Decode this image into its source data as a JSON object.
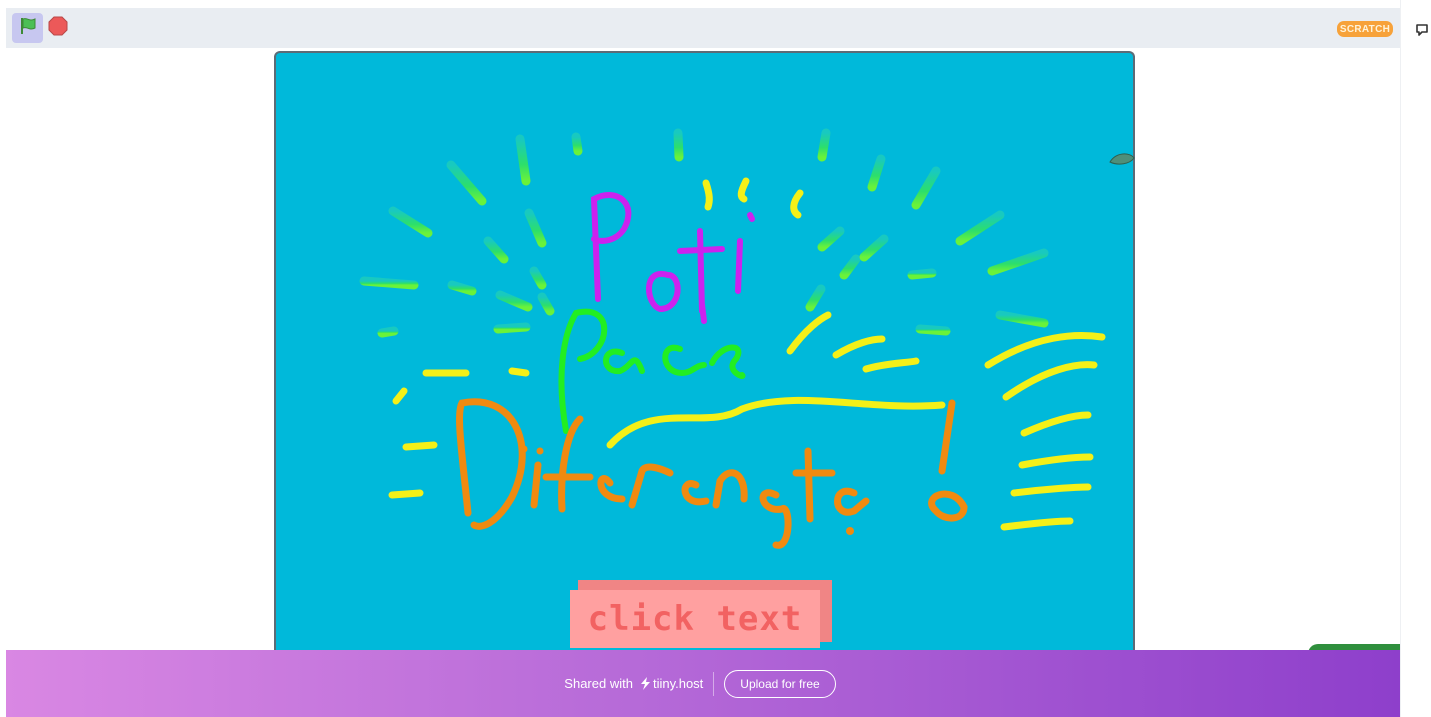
{
  "toolbar": {
    "green_flag_icon": "green-flag-icon",
    "stop_icon": "stop-sign-icon",
    "scratch_logo": "SCRATCH"
  },
  "side_panel": {
    "comment_icon": "comment-icon"
  },
  "stage": {
    "background_color": "#00b9da",
    "drawing_text_line1": "Poți",
    "drawing_text_line2": "face",
    "drawing_text_line3": "Diferența!",
    "button_label": "click text",
    "button_color": "#ffa0a0",
    "button_text_color": "#f26262"
  },
  "footer": {
    "shared_label": "Shared with",
    "brand": "tiiny.host",
    "upload_button": "Upload for free",
    "gradient_start": "#d987e3",
    "gradient_end": "#8e3fcb"
  }
}
